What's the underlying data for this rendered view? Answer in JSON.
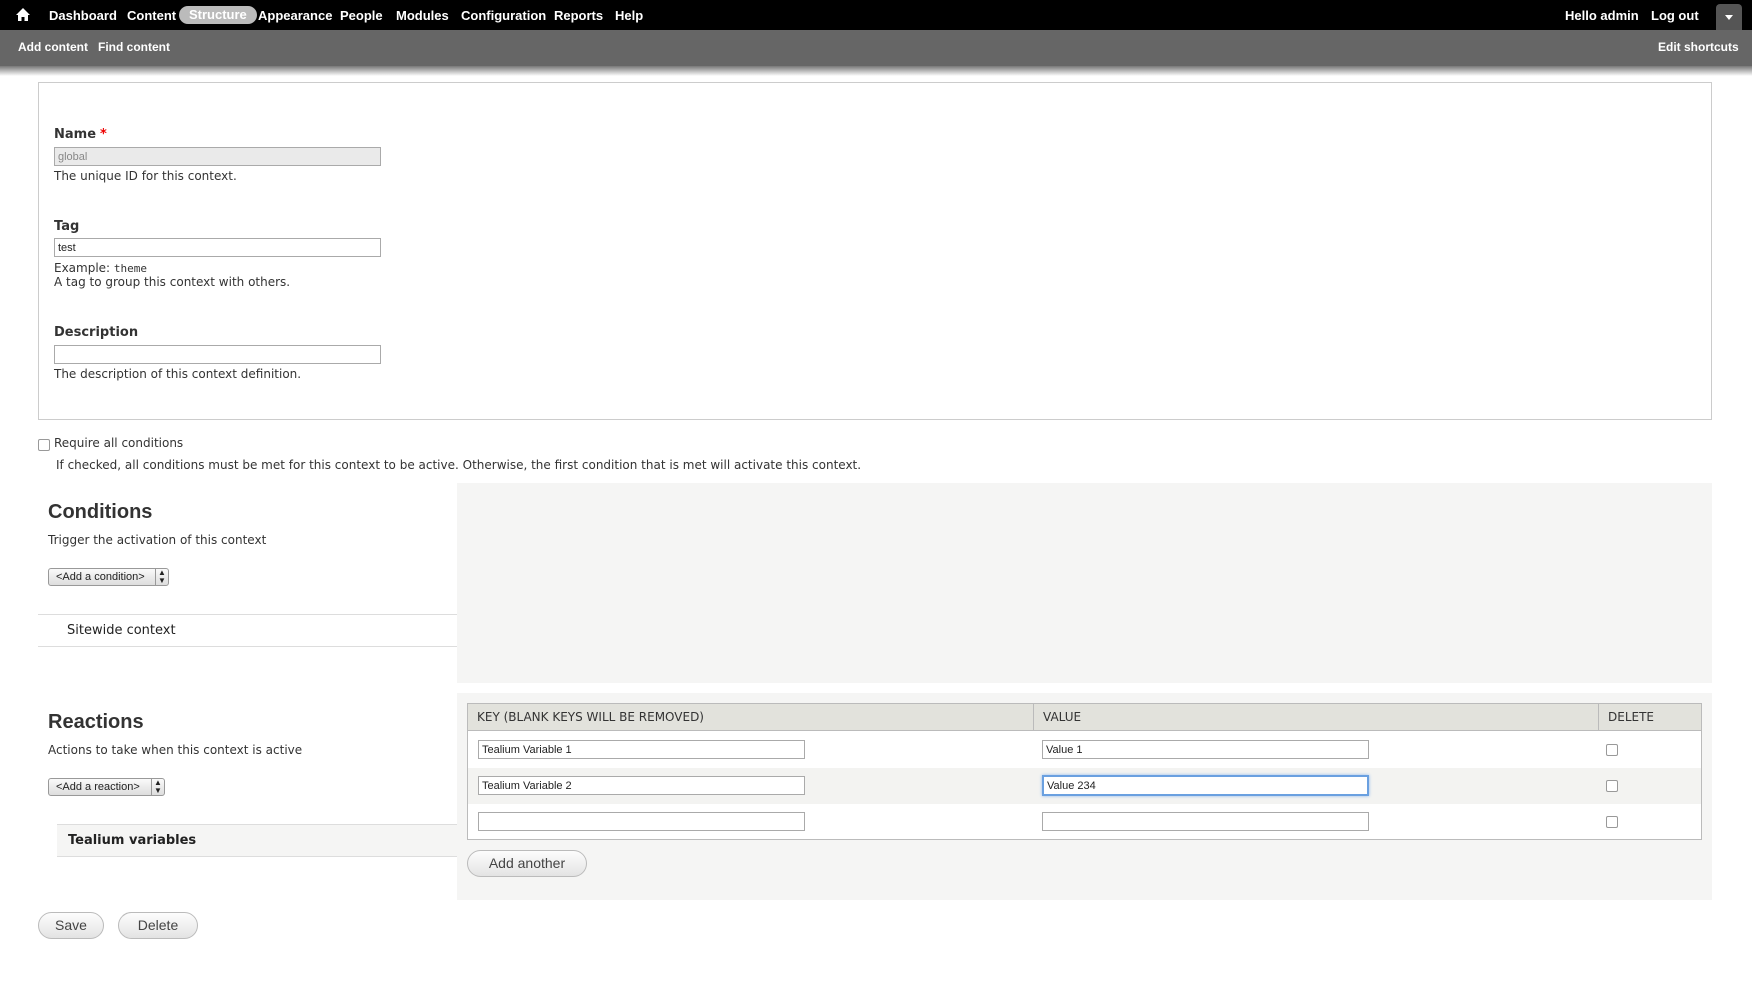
{
  "toolbar": {
    "home_icon": "home-icon",
    "menu": [
      {
        "label": "Dashboard",
        "active": false
      },
      {
        "label": "Content",
        "active": false
      },
      {
        "label": "Structure",
        "active": true
      },
      {
        "label": "Appearance",
        "active": false
      },
      {
        "label": "People",
        "active": false
      },
      {
        "label": "Modules",
        "active": false
      },
      {
        "label": "Configuration",
        "active": false
      },
      {
        "label": "Reports",
        "active": false
      },
      {
        "label": "Help",
        "active": false
      }
    ],
    "user_greeting": "Hello admin",
    "logout_label": "Log out"
  },
  "shortcuts": {
    "add_content": "Add content",
    "find_content": "Find content",
    "edit_shortcuts": "Edit shortcuts"
  },
  "form": {
    "name": {
      "label": "Name",
      "required_marker": "*",
      "value": "global",
      "description": "The unique ID for this context."
    },
    "tag": {
      "label": "Tag",
      "value": "test",
      "example_prefix": "Example: ",
      "example_code": "theme",
      "description": "A tag to group this context with others."
    },
    "description": {
      "label": "Description",
      "value": "",
      "help": "The description of this context definition."
    },
    "require_all": {
      "label": "Require all conditions",
      "checked": false,
      "description": "If checked, all conditions must be met for this context to be active. Otherwise, the first condition that is met will activate this context."
    }
  },
  "conditions": {
    "title": "Conditions",
    "description": "Trigger the activation of this context",
    "select_label": "<Add a condition>",
    "items": [
      "Sitewide context"
    ]
  },
  "reactions": {
    "title": "Reactions",
    "description": "Actions to take when this context is active",
    "select_label": "<Add a reaction>",
    "items": [
      "Tealium variables"
    ],
    "table": {
      "headers": [
        "KEY (BLANK KEYS WILL BE REMOVED)",
        "VALUE",
        "DELETE"
      ],
      "rows": [
        {
          "key": "Tealium Variable 1",
          "value": "Value 1",
          "delete": false
        },
        {
          "key": "Tealium Variable 2",
          "value": "Value 234",
          "delete": false
        },
        {
          "key": "",
          "value": "",
          "delete": false
        }
      ]
    },
    "add_another_label": "Add another"
  },
  "actions": {
    "save_label": "Save",
    "delete_label": "Delete"
  },
  "colors": {
    "toolbar_bg": "#000000",
    "shortcuts_bg": "#666666",
    "active_menu_bg": "#bbbbbb",
    "required": "#ee0000",
    "panel_bg": "#f5f5f4"
  }
}
